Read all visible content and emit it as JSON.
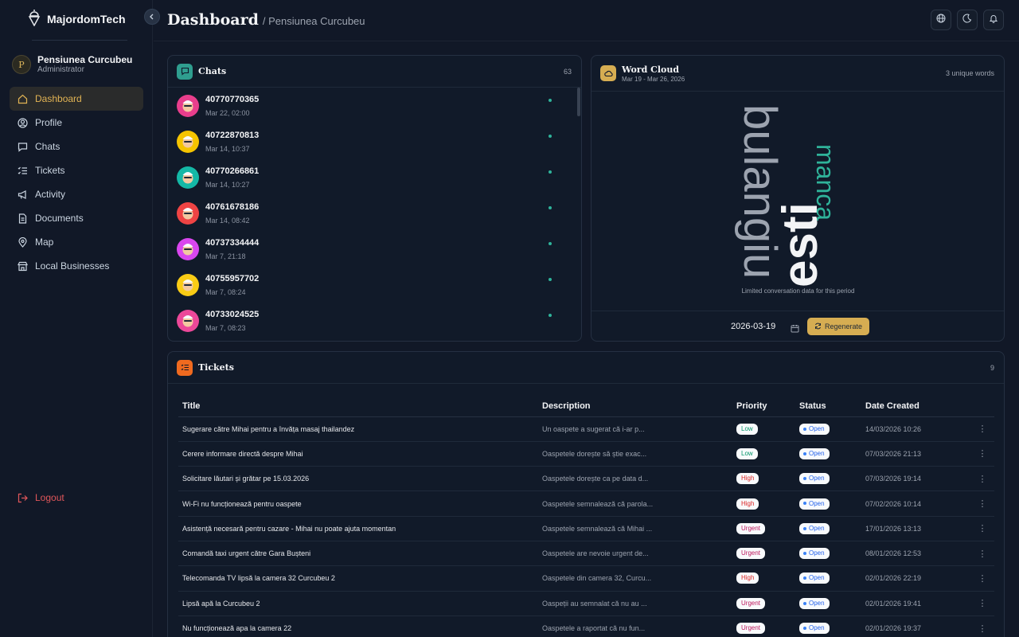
{
  "brand": {
    "name": "MajordomTech"
  },
  "user": {
    "initial": "P",
    "name": "Pensiunea Curcubeu",
    "role": "Administrator"
  },
  "nav": [
    {
      "label": "Dashboard",
      "icon": "home-icon",
      "active": true
    },
    {
      "label": "Profile",
      "icon": "user-circle-icon"
    },
    {
      "label": "Chats",
      "icon": "chat-icon"
    },
    {
      "label": "Tickets",
      "icon": "list-check-icon"
    },
    {
      "label": "Activity",
      "icon": "megaphone-icon"
    },
    {
      "label": "Documents",
      "icon": "document-icon"
    },
    {
      "label": "Map",
      "icon": "map-pin-icon"
    },
    {
      "label": "Local Businesses",
      "icon": "store-icon"
    }
  ],
  "logout": "Logout",
  "header": {
    "title": "Dashboard",
    "subtitle": "/ Pensiunea Curcubeu"
  },
  "chats": {
    "title": "Chats",
    "count": "63",
    "items": [
      {
        "number": "40770770365",
        "time": "Mar 22, 02:00",
        "color": "#e83e8c"
      },
      {
        "number": "40722870813",
        "time": "Mar 14, 10:37",
        "color": "#f5c400"
      },
      {
        "number": "40770266861",
        "time": "Mar 14, 10:27",
        "color": "#14b8a6"
      },
      {
        "number": "40761678186",
        "time": "Mar 14, 08:42",
        "color": "#ef4444"
      },
      {
        "number": "40737334444",
        "time": "Mar 7, 21:18",
        "color": "#d946ef"
      },
      {
        "number": "40755957702",
        "time": "Mar 7, 08:24",
        "color": "#facc15"
      },
      {
        "number": "40733024525",
        "time": "Mar 7, 08:23",
        "color": "#ec4899"
      }
    ]
  },
  "wordcloud": {
    "title": "Word Cloud",
    "range": "Mar 19 - Mar 26, 2026",
    "count": "3 unique words",
    "words": [
      "bulangiu",
      "esti",
      "manca"
    ],
    "note": "Limited conversation data for this period",
    "date": "2026-03-19",
    "regenerate": "Regenerate"
  },
  "tickets": {
    "title": "Tickets",
    "count": "9",
    "columns": [
      "Title",
      "Description",
      "Priority",
      "Status",
      "Date Created"
    ],
    "rows": [
      {
        "title": "Sugerare către Mihai pentru a învăța masaj thailandez",
        "description": "Un oaspete a sugerat că i-ar p...",
        "priority": "Low",
        "status": "Open",
        "date": "14/03/2026 10:26"
      },
      {
        "title": "Cerere informare directă despre Mihai",
        "description": "Oaspetele dorește să știe exac...",
        "priority": "Low",
        "status": "Open",
        "date": "07/03/2026 21:13"
      },
      {
        "title": "Solicitare lăutari și grătar pe 15.03.2026",
        "description": "Oaspetele dorește ca pe data d...",
        "priority": "High",
        "status": "Open",
        "date": "07/03/2026 19:14"
      },
      {
        "title": "Wi-Fi nu funcționează pentru oaspete",
        "description": "Oaspetele semnalează că parola...",
        "priority": "High",
        "status": "Open",
        "date": "07/02/2026 10:14"
      },
      {
        "title": "Asistență necesară pentru cazare - Mihai nu poate ajuta momentan",
        "description": "Oaspetele semnalează că Mihai ...",
        "priority": "Urgent",
        "status": "Open",
        "date": "17/01/2026 13:13"
      },
      {
        "title": "Comandă taxi urgent către Gara Bușteni",
        "description": "Oaspetele are nevoie urgent de...",
        "priority": "Urgent",
        "status": "Open",
        "date": "08/01/2026 12:53"
      },
      {
        "title": "Telecomanda TV lipsă la camera 32 Curcubeu 2",
        "description": "Oaspetele din camera 32, Curcu...",
        "priority": "High",
        "status": "Open",
        "date": "02/01/2026 22:19"
      },
      {
        "title": "Lipsă apă la Curcubeu 2",
        "description": "Oaspeții au semnalat că nu au ...",
        "priority": "Urgent",
        "status": "Open",
        "date": "02/01/2026 19:41"
      },
      {
        "title": "Nu funcționează apa la camera 22",
        "description": "Oaspetele a raportat că nu fun...",
        "priority": "Urgent",
        "status": "Open",
        "date": "02/01/2026 19:37"
      }
    ]
  },
  "colors": {
    "accent": "#d6ad52",
    "teal": "#2fb39a",
    "danger": "#e0565a",
    "background": "#111827"
  }
}
